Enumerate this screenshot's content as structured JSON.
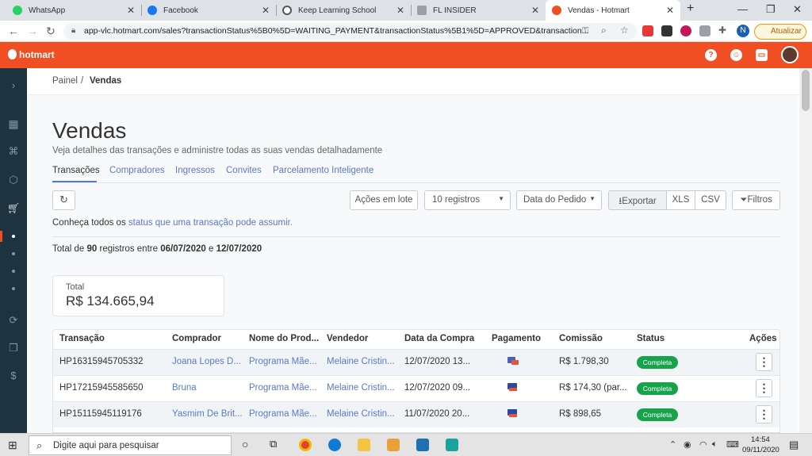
{
  "browser": {
    "tabs": [
      {
        "title": "WhatsApp",
        "color": "#25d366"
      },
      {
        "title": "Facebook",
        "color": "#1877f2"
      },
      {
        "title": "Keep Learning School",
        "color": "#555555"
      },
      {
        "title": "FL INSIDER",
        "color": "#9aa0a6"
      },
      {
        "title": "Vendas - Hotmart",
        "color": "#f04e23"
      }
    ],
    "url": "app-vlc.hotmart.com/sales?transactionStatus%5B0%5D=WAITING_PAYMENT&transactionStatus%5B1%5D=APPROVED&transaction...",
    "profile_initial": "N",
    "update_label": "Atualizar"
  },
  "header": {
    "logo": "hotmart",
    "help_glyph": "?"
  },
  "breadcrumb": {
    "root": "Painel",
    "separator": "/",
    "current": "Vendas"
  },
  "page": {
    "title": "Vendas",
    "subtitle": "Veja detalhes das transações e administre todas as suas vendas detalhadamente"
  },
  "tabs": [
    "Transações",
    "Compradores",
    "Ingressos",
    "Convites",
    "Parcelamento Inteligente"
  ],
  "toolbar": {
    "bulk_actions": "Ações em lote",
    "page_size": "10 registros",
    "sort_by": "Data do Pedido",
    "export": "Exportar",
    "xls": "XLS",
    "csv": "CSV",
    "filters": "Filtros"
  },
  "status_info": {
    "prefix": "Conheça todos os",
    "link": "status que uma transação pode assumir."
  },
  "summary": {
    "prefix": "Total de",
    "count": "90",
    "middle": "registros entre",
    "start": "06/07/2020",
    "connector": "e",
    "end": "12/07/2020"
  },
  "total_card": {
    "label": "Total",
    "value": "R$ 134.665,94"
  },
  "table": {
    "columns": [
      "Transação",
      "Comprador",
      "Nome do Prod...",
      "Vendedor",
      "Data da Compra",
      "Pagamento",
      "Comissão",
      "Status",
      "Ações"
    ],
    "rows": [
      {
        "transaction": "HP16315945705332",
        "buyer": "Joana Lopes D...",
        "product": "Programa Mãe...",
        "seller": "Melaine Cristin...",
        "date": "12/07/2020 13...",
        "commission": "R$ 1.798,30",
        "status": "Completa"
      },
      {
        "transaction": "HP17215945585650",
        "buyer": "Bruna",
        "product": "Programa Mãe...",
        "seller": "Melaine Cristin...",
        "date": "12/07/2020 09...",
        "commission": "R$ 174,30 (par...",
        "status": "Completa"
      },
      {
        "transaction": "HP15115945119176",
        "buyer": "Yasmim De Brit...",
        "product": "Programa Mãe...",
        "seller": "Melaine Cristin...",
        "date": "11/07/2020 20...",
        "commission": "R$ 898,65",
        "status": "Completa"
      }
    ]
  },
  "taskbar": {
    "search_placeholder": "Digite aqui para pesquisar",
    "time": "14:54",
    "date": "09/11/2020"
  }
}
